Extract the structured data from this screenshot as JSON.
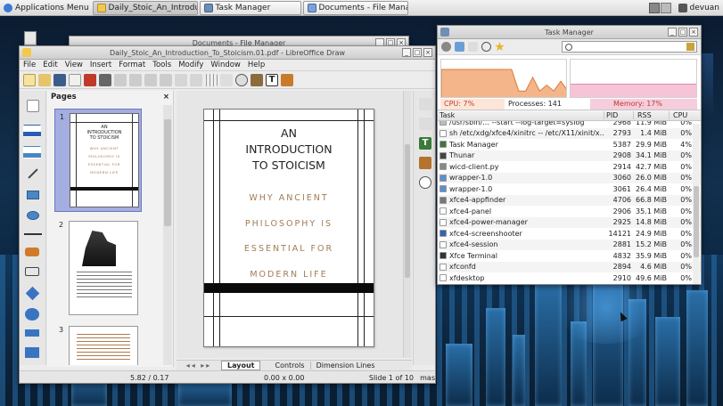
{
  "panel": {
    "apps_menu": "Applications Menu",
    "tasks": [
      "Daily_Stoic_An_Introduc...",
      "Task Manager",
      "Documents - File Manager"
    ],
    "user": "devuan"
  },
  "bg_window": {
    "title": "Documents - File Manager"
  },
  "draw": {
    "title": "Daily_Stoic_An_Introduction_To_Stoicism.01.pdf - LibreOffice Draw",
    "menu": [
      "File",
      "Edit",
      "View",
      "Insert",
      "Format",
      "Tools",
      "Modify",
      "Window",
      "Help"
    ],
    "pages_label": "Pages",
    "thumb_numbers": [
      "1",
      "2",
      "3"
    ],
    "slide": {
      "title_lines": [
        "AN",
        "INTRODUCTION",
        "TO STOICISM"
      ],
      "subtitle_lines": [
        "WHY ANCIENT",
        "PHILOSOPHY IS",
        "ESSENTIAL FOR",
        "MODERN LIFE"
      ]
    },
    "tabs": [
      "Layout",
      "Controls",
      "Dimension Lines"
    ],
    "status": {
      "position": "5.82 / 0.17",
      "size": "0.00 x 0.00",
      "slide": "Slide 1 of 10",
      "extra": "mas"
    }
  },
  "taskmgr": {
    "title": "Task Manager",
    "search_placeholder": "",
    "cpu": "CPU: 7%",
    "processes": "Processes: 141",
    "memory": "Memory: 17%",
    "cpu_history": [
      0.75,
      0.75,
      0.75,
      0.75,
      0.75,
      0.75,
      0.75,
      0.75,
      0.75,
      0.75,
      0.75,
      0.2,
      0.2,
      0.55,
      0.2,
      0.35,
      0.2,
      0.45,
      0.2
    ],
    "columns": [
      "Task",
      "PID",
      "RSS",
      "CPU"
    ],
    "rows": [
      {
        "task": "/usr/sbin/... --start --log-target=syslog",
        "pid": "2968",
        "rss": "11.9 MiB",
        "cpu": "0%",
        "icon": "#bbbbbb"
      },
      {
        "task": "sh /etc/xdg/xfce4/xinitrc -- /etc/X11/xinit/x...",
        "pid": "2793",
        "rss": "1.4 MiB",
        "cpu": "0%",
        "icon": "#ffffff"
      },
      {
        "task": "Task Manager",
        "pid": "5387",
        "rss": "29.9 MiB",
        "cpu": "4%",
        "icon": "#3a7a3a"
      },
      {
        "task": "Thunar",
        "pid": "2908",
        "rss": "34.1 MiB",
        "cpu": "0%",
        "icon": "#444444"
      },
      {
        "task": "wicd-client.py",
        "pid": "2914",
        "rss": "42.7 MiB",
        "cpu": "0%",
        "icon": "#888888"
      },
      {
        "task": "wrapper-1.0",
        "pid": "3060",
        "rss": "26.0 MiB",
        "cpu": "0%",
        "icon": "#5a8fcf"
      },
      {
        "task": "wrapper-1.0",
        "pid": "3061",
        "rss": "26.4 MiB",
        "cpu": "0%",
        "icon": "#5a8fcf"
      },
      {
        "task": "xfce4-appfinder",
        "pid": "4706",
        "rss": "66.8 MiB",
        "cpu": "0%",
        "icon": "#777777"
      },
      {
        "task": "xfce4-panel",
        "pid": "2906",
        "rss": "35.1 MiB",
        "cpu": "0%",
        "icon": "#ffffff"
      },
      {
        "task": "xfce4-power-manager",
        "pid": "2925",
        "rss": "14.8 MiB",
        "cpu": "0%",
        "icon": "#ffffff"
      },
      {
        "task": "xfce4-screenshooter",
        "pid": "14121",
        "rss": "24.9 MiB",
        "cpu": "0%",
        "icon": "#3366aa"
      },
      {
        "task": "xfce4-session",
        "pid": "2881",
        "rss": "15.2 MiB",
        "cpu": "0%",
        "icon": "#ffffff"
      },
      {
        "task": "Xfce Terminal",
        "pid": "4832",
        "rss": "35.9 MiB",
        "cpu": "0%",
        "icon": "#333333"
      },
      {
        "task": "xfconfd",
        "pid": "2894",
        "rss": "4.6 MiB",
        "cpu": "0%",
        "icon": "#ffffff"
      },
      {
        "task": "xfdesktop",
        "pid": "2910",
        "rss": "49.6 MiB",
        "cpu": "0%",
        "icon": "#ffffff"
      }
    ]
  }
}
